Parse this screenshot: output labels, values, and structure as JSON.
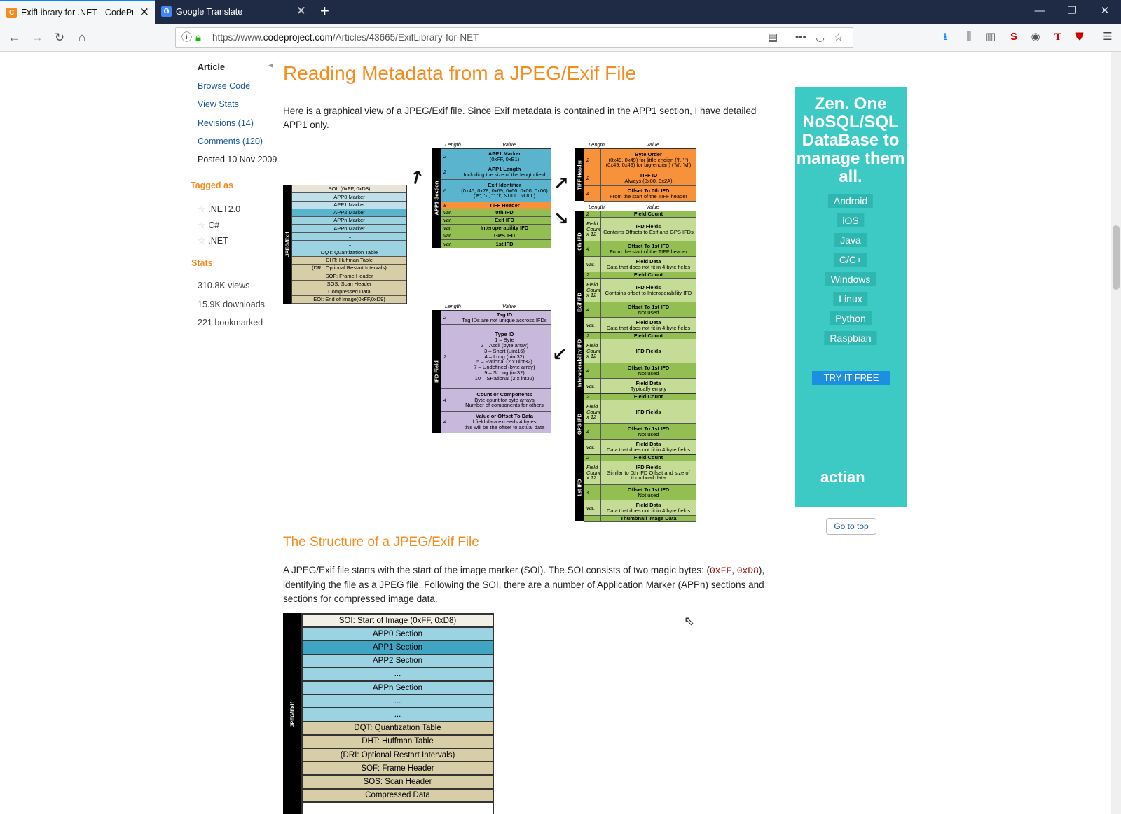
{
  "browser": {
    "tabs": [
      {
        "title": "ExifLibrary for .NET - CodeProje",
        "favicon": "codeproject-icon",
        "active": true
      },
      {
        "title": "Google Translate",
        "favicon": "google-translate-icon",
        "active": false
      }
    ],
    "url_prefix": "https://www.",
    "url_domain": "codeproject.com",
    "url_path": "/Articles/43665/ExifLibrary-for-NET"
  },
  "sidebar": {
    "current": "Article",
    "links": [
      "Browse Code",
      "View Stats",
      "Revisions (14)",
      "Comments (120)"
    ],
    "posted": "Posted 10 Nov 2009",
    "tagged_heading": "Tagged as",
    "tags": [
      ".NET2.0",
      "C#",
      ".NET"
    ],
    "stats_heading": "Stats",
    "stats": [
      "310.8K views",
      "15.9K downloads",
      "221 bookmarked"
    ]
  },
  "article": {
    "title": "Reading Metadata from a JPEG/Exif File",
    "intro": "Here is a graphical view of a JPEG/Exif file. Since Exif metadata is contained in the APP1 section, I have detailed APP1 only.",
    "subheading": "The Structure of a JPEG/Exif File",
    "p2_a": "A JPEG/Exif file starts with the start of the image marker (SOI). The SOI consists of two magic bytes: (",
    "p2_code1": "0xFF",
    "p2_sep": ", ",
    "p2_code2": "0xD8",
    "p2_b": "), identifying the file as a JPEG file. Following the SOI, there are a number of Application Marker (APPn) sections and sections for compressed image data."
  },
  "diagram": {
    "col_length": "Length",
    "col_value": "Value",
    "jpeg_label": "JPEG/Exif",
    "jpeg_rows": [
      "SOI: (0xFF, 0xD8)",
      "APP0 Marker",
      "APP1 Marker",
      "APP2 Marker",
      "APPn Marker",
      "APPn Marker",
      "...",
      "...",
      "DQT: Quantization Table",
      "DHT: Huffman Table",
      "(DRI: Optional Restart Intervals)",
      "SOF: Frame Header",
      "SOS: Scan Header",
      "Compressed Data",
      "EOI: End of Image(0xFF,0xD9)"
    ],
    "app1_label": "APP1 Section",
    "app1_rows": [
      {
        "len": "2",
        "title": "APP1 Marker",
        "desc": "(0xFF, 0xE1)"
      },
      {
        "len": "2",
        "title": "APP1 Length",
        "desc": "Including the size of the length field"
      },
      {
        "len": "6",
        "title": "Exif Identifier",
        "desc": "(0x45, 0x78, 0x69, 0x66, 0x00, 0x00) ('E', 'x', 'i', 'f', NULL, NULL)"
      },
      {
        "len": "8",
        "title": "TIFF Header",
        "desc": ""
      },
      {
        "len": "var.",
        "title": "0th IFD",
        "desc": ""
      },
      {
        "len": "var.",
        "title": "Exif IFD",
        "desc": ""
      },
      {
        "len": "var.",
        "title": "Interoperability IFD",
        "desc": ""
      },
      {
        "len": "var.",
        "title": "GPS IFD",
        "desc": ""
      },
      {
        "len": "var.",
        "title": "1st IFD",
        "desc": ""
      }
    ],
    "tiff_label": "TIFF Header",
    "tiff_rows": [
      {
        "len": "2",
        "title": "Byte Order",
        "desc": "(0x49, 0x49) for little endian ('I', 'I') (0x49, 0x49) for big-endian) ('M', 'M')"
      },
      {
        "len": "2",
        "title": "TIFF ID",
        "desc": "Always (0x00, 0x2A)"
      },
      {
        "len": "4",
        "title": "Offset To 0th IFD",
        "desc": "From the start of the TIFF header"
      }
    ],
    "ifd_groups": [
      {
        "label": "0th IFD",
        "rows": [
          {
            "len": "2",
            "title": "Field Count",
            "desc": ""
          },
          {
            "len": "Field Count x 12",
            "title": "IFD Fields",
            "desc": "Contains Offsets to Exif and GPS IFDs"
          },
          {
            "len": "4",
            "title": "Offset To 1st IFD",
            "desc": "From the start of the TIFF header"
          },
          {
            "len": "var.",
            "title": "Field Data",
            "desc": "Data that does not fit in 4 byte fields"
          }
        ]
      },
      {
        "label": "Exif IFD",
        "rows": [
          {
            "len": "2",
            "title": "Field Count",
            "desc": ""
          },
          {
            "len": "Field Count x 12",
            "title": "IFD Fields",
            "desc": "Contains offset to Interoperability IFD"
          },
          {
            "len": "4",
            "title": "Offset To 1st IFD",
            "desc": "Not used"
          },
          {
            "len": "var.",
            "title": "Field Data",
            "desc": "Data that does not fit in 4 byte fields"
          }
        ]
      },
      {
        "label": "Interoperability IFD",
        "rows": [
          {
            "len": "2",
            "title": "Field Count",
            "desc": ""
          },
          {
            "len": "Field Count x 12",
            "title": "IFD Fields",
            "desc": ""
          },
          {
            "len": "4",
            "title": "Offset To 1st IFD",
            "desc": "Not used"
          },
          {
            "len": "var.",
            "title": "Field Data",
            "desc": "Typically empty"
          }
        ]
      },
      {
        "label": "GPS IFD",
        "rows": [
          {
            "len": "2",
            "title": "Field Count",
            "desc": ""
          },
          {
            "len": "Field Count x 12",
            "title": "IFD Fields",
            "desc": ""
          },
          {
            "len": "4",
            "title": "Offset To 1st IFD",
            "desc": "Not used"
          },
          {
            "len": "var.",
            "title": "Field Data",
            "desc": "Data that does not fit in 4 byte fields"
          }
        ]
      },
      {
        "label": "1st IFD",
        "rows": [
          {
            "len": "2",
            "title": "Field Count",
            "desc": ""
          },
          {
            "len": "Field Count x 12",
            "title": "IFD Fields",
            "desc": "Similar to 0th IFD Offset and size of thumbnail data"
          },
          {
            "len": "4",
            "title": "Offset To 1st IFD",
            "desc": "Not used"
          },
          {
            "len": "var.",
            "title": "Field Data",
            "desc": "Data that does not fit in 4 byte fields"
          },
          {
            "len": "",
            "title": "Thumbnail Image Data",
            "desc": ""
          }
        ]
      }
    ],
    "field_label": "IFD Field",
    "field_rows": [
      {
        "len": "2",
        "title": "Tag ID",
        "desc": "Tag IDs are not unique accross IFDs"
      },
      {
        "len": "2",
        "title": "Type ID",
        "desc": "1 – Byte|2 – Ascii (byte array)|3 – Short (uint16)|4 – Long (uint32)|5 – Rational (2 x uint32)|7 – Undefined (byte array)|9 – SLong (int32)|10 – SRational (2 x int32)"
      },
      {
        "len": "4",
        "title": "Count or Components",
        "desc": "Byte count for byte arrays|Number of components for others"
      },
      {
        "len": "4",
        "title": "Value or Offset To Data",
        "desc": "If field data exceeds 4 bytes,|this will be the offset to actual data"
      }
    ],
    "big_rows": [
      "SOI: Start of Image (0xFF, 0xD8)",
      "APP0 Section",
      "APP1 Section",
      "APP2 Section",
      "...",
      "APPn Section",
      "...",
      "...",
      "DQT: Quantization Table",
      "DHT: Huffman Table",
      "(DRI: Optional Restart Intervals)",
      "SOF: Frame Header",
      "SOS: Scan Header",
      "Compressed Data"
    ]
  },
  "ad": {
    "headline": "Zen. One NoSQL/SQL DataBase to manage them all.",
    "languages": [
      "Android",
      "iOS",
      "Java",
      "C/C+",
      "Windows",
      "Linux",
      "Python",
      "Raspbian"
    ],
    "cta": "TRY IT FREE",
    "brand": "actian"
  },
  "go_to_top": "Go to top"
}
